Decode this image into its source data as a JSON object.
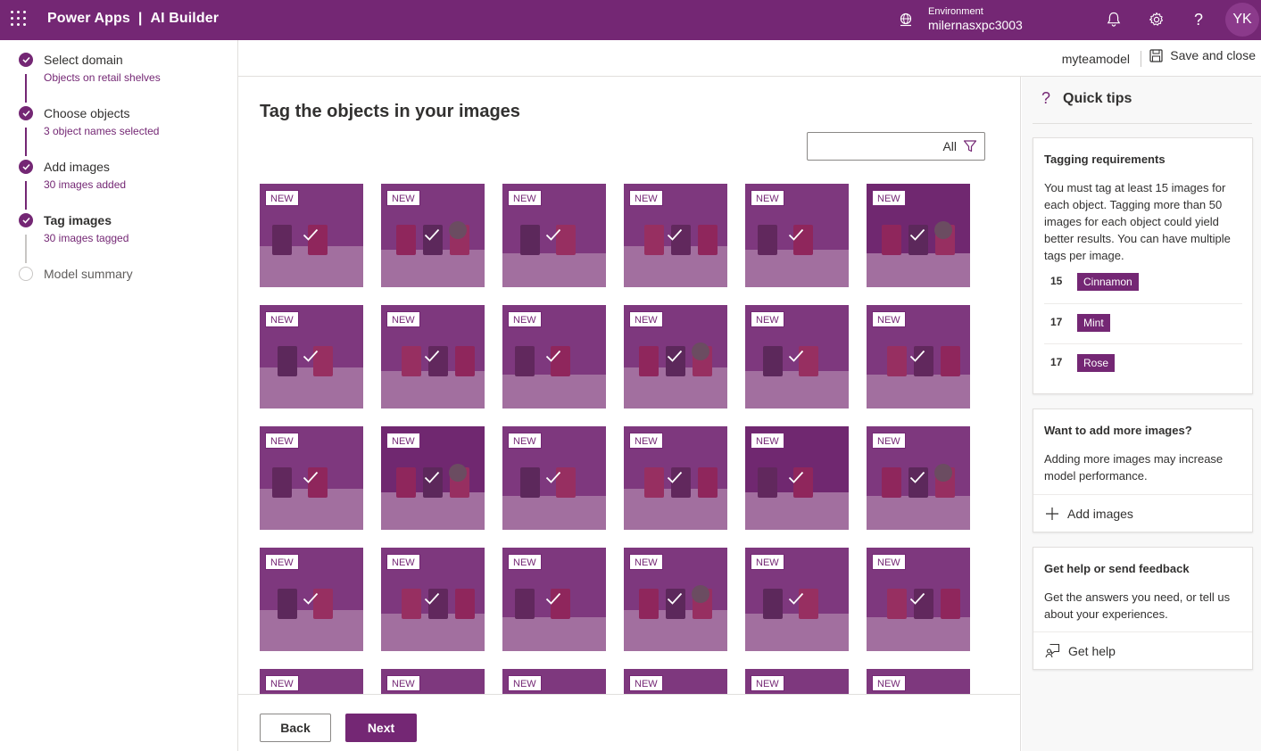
{
  "header": {
    "app_name": "Power Apps",
    "product_name": "AI Builder",
    "environment_label": "Environment",
    "environment_value": "milernasxpc3003",
    "avatar_initials": "YK"
  },
  "steps": [
    {
      "title": "Select domain",
      "subtitle": "Objects on retail shelves",
      "state": "done"
    },
    {
      "title": "Choose objects",
      "subtitle": "3 object names selected",
      "state": "done"
    },
    {
      "title": "Add images",
      "subtitle": "30 images added",
      "state": "done"
    },
    {
      "title": "Tag images",
      "subtitle": "30 images tagged",
      "state": "current"
    },
    {
      "title": "Model summary",
      "subtitle": "",
      "state": "todo"
    }
  ],
  "command_bar": {
    "model_name": "myteamodel",
    "save_label": "Save and close"
  },
  "main": {
    "title": "Tag the objects in your images",
    "filter_value": "All",
    "image_badge": "NEW",
    "image_count_visible": 30
  },
  "footer": {
    "back_label": "Back",
    "next_label": "Next"
  },
  "quick_tips": {
    "title": "Quick tips",
    "tagging": {
      "heading": "Tagging requirements",
      "body": "You must tag at least 15 images for each object. Tagging more than 50 images for each object could yield better results. You can have multiple tags per image.",
      "tags": [
        {
          "count": "15",
          "name": "Cinnamon"
        },
        {
          "count": "17",
          "name": "Mint"
        },
        {
          "count": "17",
          "name": "Rose"
        }
      ]
    },
    "more_images": {
      "heading": "Want to add more images?",
      "body": "Adding more images may increase model performance.",
      "action": "Add images"
    },
    "help": {
      "heading": "Get help or send feedback",
      "body": "Get the answers you need, or tell us about your experiences.",
      "action": "Get help"
    }
  },
  "colors": {
    "brand": "#742774",
    "border": "#e1dfdd"
  }
}
